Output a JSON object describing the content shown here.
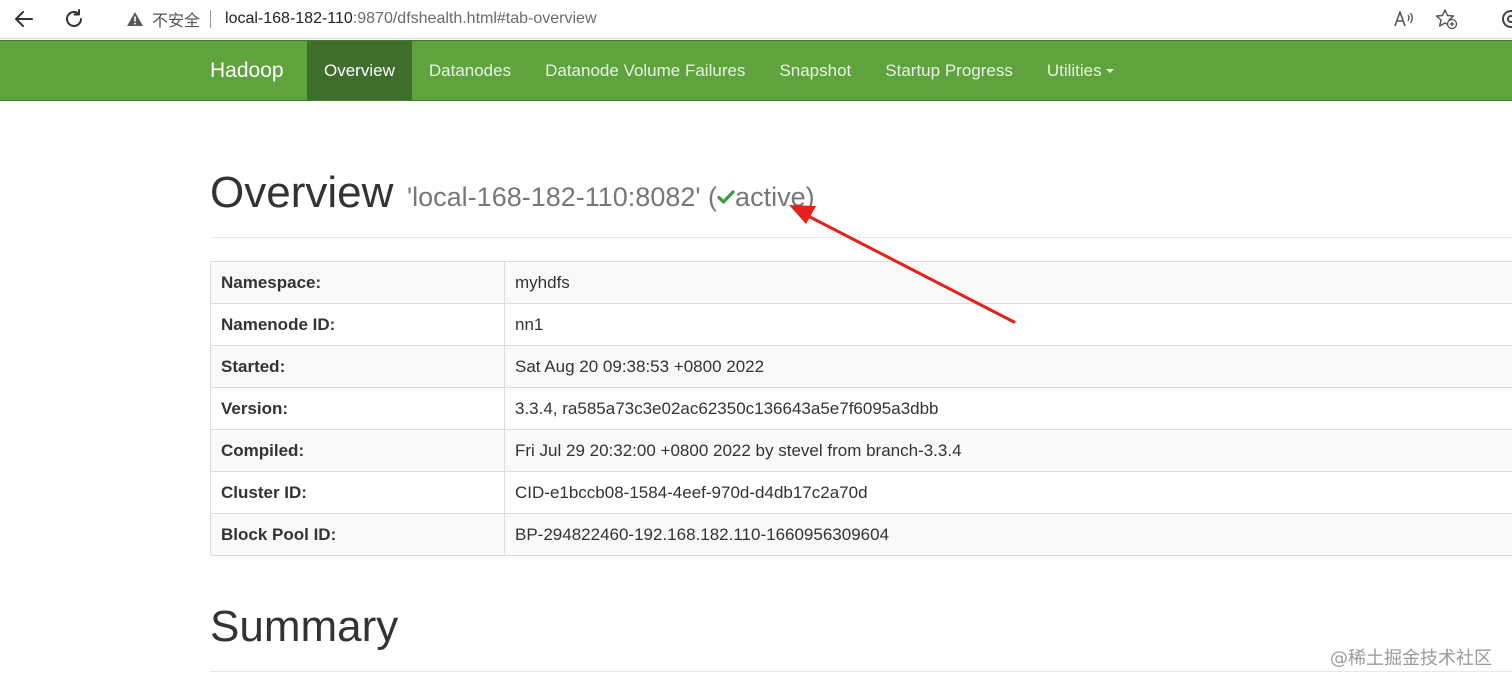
{
  "browser": {
    "security_label": "不安全",
    "url_host": "local-168-182-110",
    "url_rest": ":9870/dfshealth.html#tab-overview",
    "icons": [
      "back-arrow-icon",
      "reload-icon",
      "warning-icon",
      "read-aloud-icon",
      "add-favorite-icon",
      "extensions-icon"
    ]
  },
  "navbar": {
    "brand": "Hadoop",
    "items": [
      {
        "label": "Overview",
        "active": true
      },
      {
        "label": "Datanodes",
        "active": false
      },
      {
        "label": "Datanode Volume Failures",
        "active": false
      },
      {
        "label": "Snapshot",
        "active": false
      },
      {
        "label": "Startup Progress",
        "active": false
      },
      {
        "label": "Utilities",
        "active": false,
        "dropdown": true
      }
    ],
    "colors": {
      "background": "#5fa33e",
      "active": "#3f6e2c"
    }
  },
  "overview": {
    "title": "Overview",
    "host": "'local-168-182-110:8082'",
    "open_paren": "(",
    "state": "active",
    "close_paren": ")",
    "state_color": "#3c9a3c"
  },
  "info_rows": [
    {
      "label": "Namespace:",
      "value": "myhdfs"
    },
    {
      "label": "Namenode ID:",
      "value": "nn1"
    },
    {
      "label": "Started:",
      "value": "Sat Aug 20 09:38:53 +0800 2022"
    },
    {
      "label": "Version:",
      "value": "3.3.4, ra585a73c3e02ac62350c136643a5e7f6095a3dbb"
    },
    {
      "label": "Compiled:",
      "value": "Fri Jul 29 20:32:00 +0800 2022 by stevel from branch-3.3.4"
    },
    {
      "label": "Cluster ID:",
      "value": "CID-e1bccb08-1584-4eef-970d-d4db17c2a70d"
    },
    {
      "label": "Block Pool ID:",
      "value": "BP-294822460-192.168.182.110-1660956309604"
    }
  ],
  "summary": {
    "title": "Summary"
  },
  "watermark": "@稀土掘金技术社区",
  "annotation_color": "#e8201c"
}
